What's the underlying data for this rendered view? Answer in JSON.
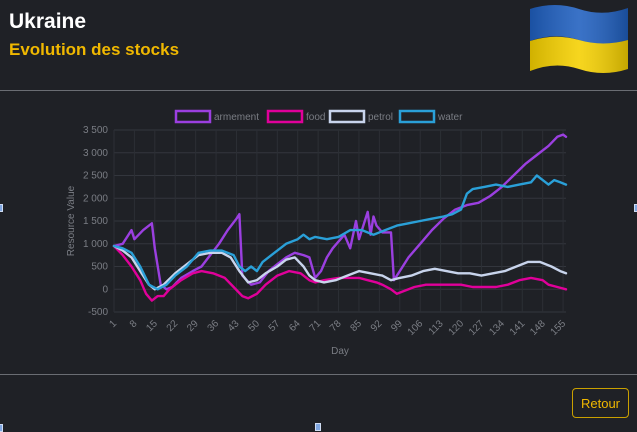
{
  "header": {
    "title": "Ukraine",
    "subtitle": "Evolution des stocks"
  },
  "flag": {
    "name": "ukraine-flag",
    "colors": [
      "#1f5fbf",
      "#f5d000"
    ]
  },
  "button": {
    "retour_label": "Retour"
  },
  "chart_data": {
    "type": "line",
    "xlabel": "Day",
    "ylabel": "Resource Value",
    "ylim": [
      -500,
      3500
    ],
    "yticks": [
      -500,
      0,
      500,
      1000,
      1500,
      2000,
      2500,
      3000,
      3500
    ],
    "ytick_labels": [
      "-500",
      "0",
      "500",
      "1 000",
      "1 500",
      "2 000",
      "2 500",
      "3 000",
      "3 500"
    ],
    "xlim": [
      1,
      156
    ],
    "xticks": [
      1,
      8,
      15,
      22,
      29,
      36,
      43,
      50,
      57,
      64,
      71,
      78,
      85,
      92,
      99,
      106,
      113,
      120,
      127,
      134,
      141,
      148,
      155
    ],
    "grid": true,
    "legend_position": "top",
    "series": [
      {
        "name": "armement",
        "color": "#9b3fe0",
        "points": [
          [
            1,
            950
          ],
          [
            4,
            1000
          ],
          [
            7,
            1300
          ],
          [
            8,
            1100
          ],
          [
            11,
            1300
          ],
          [
            14,
            1450
          ],
          [
            15,
            900
          ],
          [
            17,
            100
          ],
          [
            19,
            0
          ],
          [
            21,
            50
          ],
          [
            24,
            250
          ],
          [
            28,
            400
          ],
          [
            31,
            500
          ],
          [
            34,
            750
          ],
          [
            37,
            1000
          ],
          [
            40,
            1300
          ],
          [
            43,
            1550
          ],
          [
            44,
            1650
          ],
          [
            45,
            300
          ],
          [
            48,
            100
          ],
          [
            51,
            150
          ],
          [
            54,
            400
          ],
          [
            57,
            550
          ],
          [
            60,
            700
          ],
          [
            63,
            800
          ],
          [
            66,
            750
          ],
          [
            68,
            700
          ],
          [
            70,
            250
          ],
          [
            72,
            400
          ],
          [
            74,
            700
          ],
          [
            76,
            900
          ],
          [
            80,
            1200
          ],
          [
            82,
            900
          ],
          [
            84,
            1500
          ],
          [
            85,
            1100
          ],
          [
            87,
            1500
          ],
          [
            88,
            1700
          ],
          [
            89,
            1200
          ],
          [
            90,
            1600
          ],
          [
            91,
            1400
          ],
          [
            93,
            1250
          ],
          [
            96,
            1250
          ],
          [
            97,
            200
          ],
          [
            99,
            400
          ],
          [
            102,
            700
          ],
          [
            106,
            1000
          ],
          [
            110,
            1300
          ],
          [
            114,
            1550
          ],
          [
            118,
            1750
          ],
          [
            122,
            1850
          ],
          [
            126,
            1900
          ],
          [
            130,
            2050
          ],
          [
            134,
            2250
          ],
          [
            138,
            2500
          ],
          [
            142,
            2750
          ],
          [
            146,
            2950
          ],
          [
            150,
            3150
          ],
          [
            153,
            3350
          ],
          [
            155,
            3400
          ],
          [
            156,
            3350
          ]
        ]
      },
      {
        "name": "food",
        "color": "#e0009a",
        "points": [
          [
            1,
            950
          ],
          [
            4,
            750
          ],
          [
            7,
            500
          ],
          [
            10,
            200
          ],
          [
            12,
            -100
          ],
          [
            14,
            -250
          ],
          [
            16,
            -150
          ],
          [
            18,
            -150
          ],
          [
            20,
            0
          ],
          [
            24,
            200
          ],
          [
            28,
            350
          ],
          [
            31,
            400
          ],
          [
            35,
            350
          ],
          [
            39,
            250
          ],
          [
            42,
            50
          ],
          [
            45,
            -150
          ],
          [
            47,
            -200
          ],
          [
            50,
            -100
          ],
          [
            53,
            100
          ],
          [
            57,
            300
          ],
          [
            61,
            400
          ],
          [
            65,
            350
          ],
          [
            68,
            200
          ],
          [
            70,
            150
          ],
          [
            73,
            200
          ],
          [
            78,
            250
          ],
          [
            82,
            250
          ],
          [
            85,
            250
          ],
          [
            88,
            200
          ],
          [
            91,
            150
          ],
          [
            93,
            100
          ],
          [
            96,
            0
          ],
          [
            98,
            -100
          ],
          [
            100,
            -50
          ],
          [
            104,
            50
          ],
          [
            108,
            100
          ],
          [
            112,
            100
          ],
          [
            116,
            100
          ],
          [
            120,
            100
          ],
          [
            124,
            50
          ],
          [
            128,
            50
          ],
          [
            132,
            50
          ],
          [
            136,
            100
          ],
          [
            140,
            200
          ],
          [
            144,
            250
          ],
          [
            148,
            200
          ],
          [
            150,
            100
          ],
          [
            153,
            50
          ],
          [
            156,
            0
          ]
        ]
      },
      {
        "name": "petrol",
        "color": "#c8d4ec",
        "points": [
          [
            1,
            950
          ],
          [
            4,
            850
          ],
          [
            7,
            700
          ],
          [
            10,
            400
          ],
          [
            13,
            100
          ],
          [
            15,
            0
          ],
          [
            18,
            100
          ],
          [
            22,
            350
          ],
          [
            26,
            550
          ],
          [
            30,
            750
          ],
          [
            34,
            800
          ],
          [
            38,
            800
          ],
          [
            41,
            700
          ],
          [
            44,
            400
          ],
          [
            47,
            150
          ],
          [
            50,
            200
          ],
          [
            53,
            350
          ],
          [
            57,
            500
          ],
          [
            60,
            650
          ],
          [
            63,
            700
          ],
          [
            66,
            500
          ],
          [
            68,
            300
          ],
          [
            70,
            200
          ],
          [
            73,
            150
          ],
          [
            77,
            200
          ],
          [
            81,
            300
          ],
          [
            85,
            400
          ],
          [
            89,
            350
          ],
          [
            93,
            300
          ],
          [
            96,
            200
          ],
          [
            99,
            250
          ],
          [
            103,
            300
          ],
          [
            107,
            400
          ],
          [
            111,
            450
          ],
          [
            115,
            400
          ],
          [
            119,
            350
          ],
          [
            123,
            350
          ],
          [
            127,
            300
          ],
          [
            131,
            350
          ],
          [
            135,
            400
          ],
          [
            139,
            500
          ],
          [
            143,
            600
          ],
          [
            147,
            600
          ],
          [
            151,
            500
          ],
          [
            154,
            400
          ],
          [
            156,
            350
          ]
        ]
      },
      {
        "name": "water",
        "color": "#2aa0d8",
        "points": [
          [
            1,
            950
          ],
          [
            4,
            900
          ],
          [
            7,
            800
          ],
          [
            10,
            500
          ],
          [
            13,
            100
          ],
          [
            16,
            0
          ],
          [
            19,
            100
          ],
          [
            22,
            300
          ],
          [
            26,
            500
          ],
          [
            30,
            800
          ],
          [
            34,
            850
          ],
          [
            38,
            850
          ],
          [
            42,
            750
          ],
          [
            44,
            500
          ],
          [
            46,
            400
          ],
          [
            48,
            500
          ],
          [
            50,
            400
          ],
          [
            52,
            600
          ],
          [
            56,
            800
          ],
          [
            60,
            1000
          ],
          [
            64,
            1100
          ],
          [
            66,
            1200
          ],
          [
            68,
            1100
          ],
          [
            70,
            1150
          ],
          [
            74,
            1100
          ],
          [
            78,
            1150
          ],
          [
            82,
            1300
          ],
          [
            86,
            1300
          ],
          [
            90,
            1200
          ],
          [
            94,
            1300
          ],
          [
            98,
            1400
          ],
          [
            102,
            1450
          ],
          [
            106,
            1500
          ],
          [
            110,
            1550
          ],
          [
            114,
            1600
          ],
          [
            117,
            1650
          ],
          [
            120,
            1750
          ],
          [
            122,
            2100
          ],
          [
            124,
            2200
          ],
          [
            128,
            2250
          ],
          [
            132,
            2300
          ],
          [
            136,
            2250
          ],
          [
            140,
            2300
          ],
          [
            144,
            2350
          ],
          [
            146,
            2500
          ],
          [
            148,
            2400
          ],
          [
            150,
            2300
          ],
          [
            152,
            2400
          ],
          [
            154,
            2350
          ],
          [
            156,
            2300
          ]
        ]
      }
    ]
  }
}
